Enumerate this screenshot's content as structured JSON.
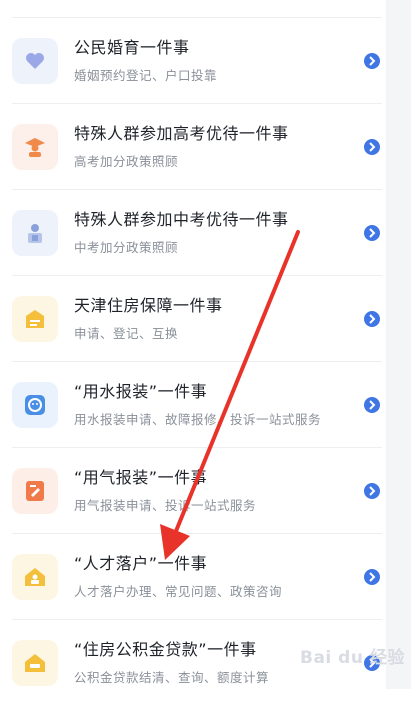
{
  "items": [
    {
      "title": "公民婚育一件事",
      "subtitle": "婚姻预约登记、户口投靠",
      "icon": "heart-icon",
      "icon_bg": "#eef2fb",
      "icon_color": "#9aa8e8"
    },
    {
      "title": "特殊人群参加高考优待一件事",
      "subtitle": "高考加分政策照顾",
      "icon": "graduate-icon",
      "icon_bg": "#fdf0ea",
      "icon_color": "#f08a4b"
    },
    {
      "title": "特殊人群参加中考优待一件事",
      "subtitle": "中考加分政策照顾",
      "icon": "student-icon",
      "icon_bg": "#eef2fb",
      "icon_color": "#8aa0d8"
    },
    {
      "title": "天津住房保障一件事",
      "subtitle": "申请、登记、互换",
      "icon": "house-card-icon",
      "icon_bg": "#fdf6e3",
      "icon_color": "#f4bf3a"
    },
    {
      "title": "“用水报装”一件事",
      "subtitle": "用水报装申请、故障报修、投诉一站式服务",
      "icon": "water-drop-icon",
      "icon_bg": "#eaf2fd",
      "icon_color": "#4a8fe6"
    },
    {
      "title": "“用气报装”一件事",
      "subtitle": "用气报装申请、投诉一站式服务",
      "icon": "gas-form-icon",
      "icon_bg": "#fdeee8",
      "icon_color": "#f07a4a"
    },
    {
      "title": "“人才落户”一件事",
      "subtitle": "人才落户办理、常见问题、政策咨询",
      "icon": "talent-house-icon",
      "icon_bg": "#fdf6e3",
      "icon_color": "#f4bf3a"
    },
    {
      "title": "“住房公积金贷款”一件事",
      "subtitle": "公积金贷款结清、查询、额度计算",
      "icon": "fund-house-icon",
      "icon_bg": "#fdf6e3",
      "icon_color": "#f4bf3a"
    }
  ],
  "annotation_color": "#e8332a",
  "watermark": "Bai du 经验"
}
